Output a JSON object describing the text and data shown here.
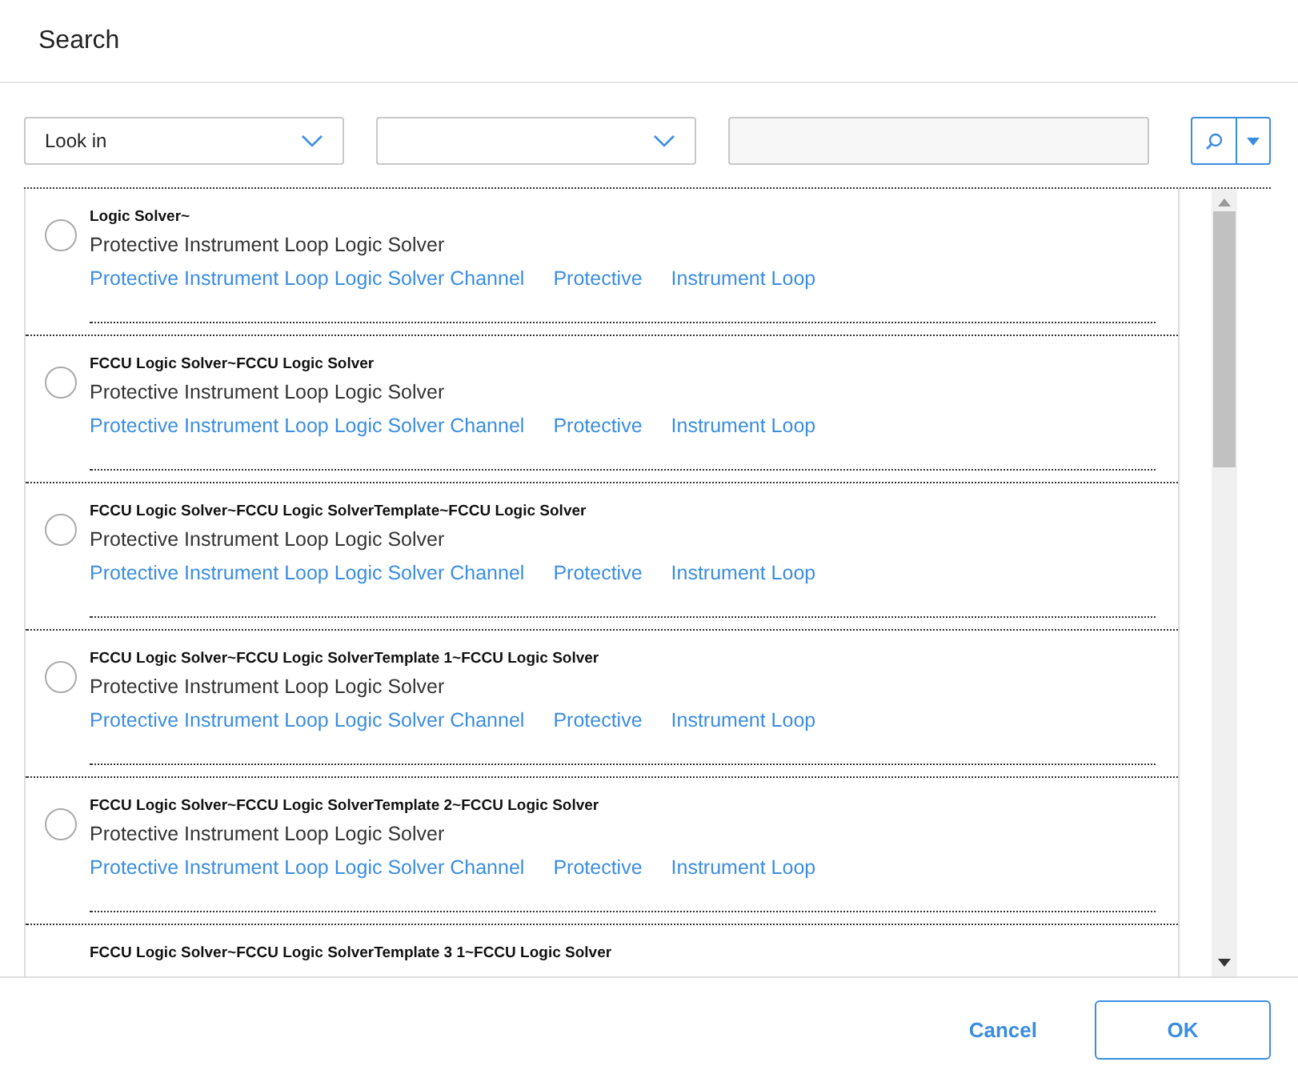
{
  "window": {
    "title": "Search"
  },
  "toolbar": {
    "look_in": {
      "value": "Look in"
    }
  },
  "results": [
    {
      "title": "Logic Solver~",
      "type": "Protective Instrument Loop Logic Solver",
      "links": [
        "Protective Instrument Loop Logic Solver Channel",
        "Protective",
        "Instrument Loop"
      ],
      "selected": false
    },
    {
      "title": "FCCU Logic Solver~FCCU Logic Solver",
      "type": "Protective Instrument Loop Logic Solver",
      "links": [
        "Protective Instrument Loop Logic Solver Channel",
        "Protective",
        "Instrument Loop"
      ],
      "selected": false
    },
    {
      "title": "FCCU Logic Solver~FCCU Logic SolverTemplate~FCCU Logic Solver",
      "type": "Protective Instrument Loop Logic Solver",
      "links": [
        "Protective Instrument Loop Logic Solver Channel",
        "Protective",
        "Instrument Loop"
      ],
      "selected": false
    },
    {
      "title": "FCCU Logic Solver~FCCU Logic SolverTemplate 1~FCCU Logic Solver",
      "type": "Protective Instrument Loop Logic Solver",
      "links": [
        "Protective Instrument Loop Logic Solver Channel",
        "Protective",
        "Instrument Loop"
      ],
      "selected": false
    },
    {
      "title": "FCCU Logic Solver~FCCU Logic SolverTemplate 2~FCCU Logic Solver",
      "type": "Protective Instrument Loop Logic Solver",
      "links": [
        "Protective Instrument Loop Logic Solver Channel",
        "Protective",
        "Instrument Loop"
      ],
      "selected": false
    },
    {
      "title": "FCCU Logic Solver~FCCU Logic SolverTemplate 3 1~FCCU Logic Solver"
    }
  ],
  "buttons": {
    "cancel": "Cancel",
    "ok": "OK"
  }
}
